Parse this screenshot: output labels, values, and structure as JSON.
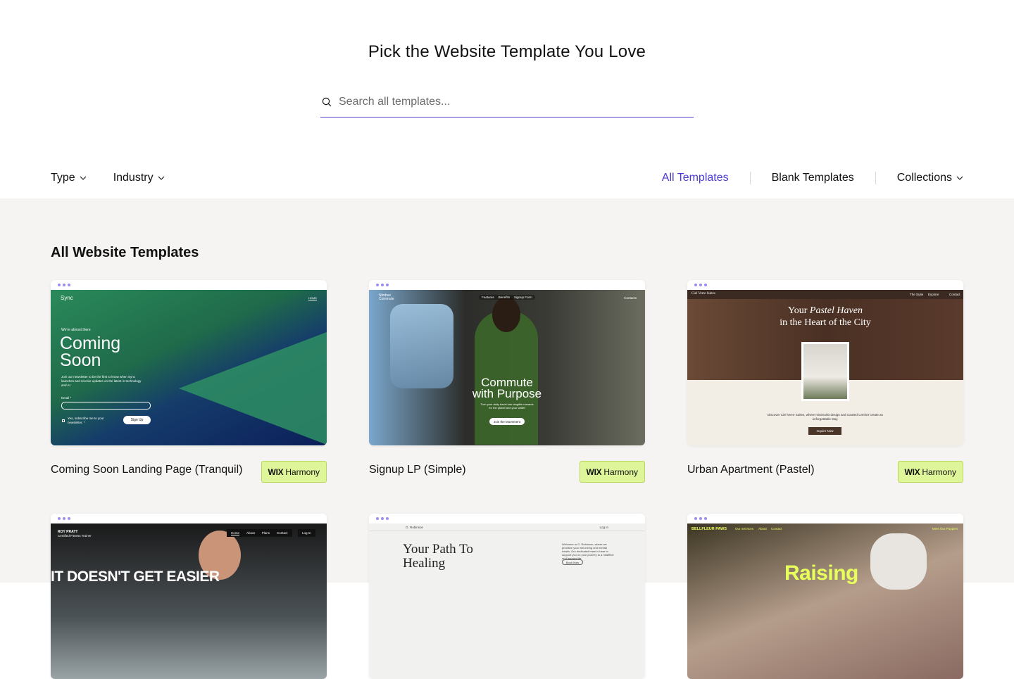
{
  "header": {
    "title": "Pick the Website Template You Love",
    "search_placeholder": "Search all templates..."
  },
  "filters": [
    {
      "label": "Type"
    },
    {
      "label": "Industry"
    }
  ],
  "tabs": [
    {
      "label": "All Templates",
      "active": true
    },
    {
      "label": "Blank Templates"
    },
    {
      "label": "Collections"
    }
  ],
  "section_title": "All Website Templates",
  "badge": {
    "brand": "WIX",
    "label": "Harmony"
  },
  "cards": [
    {
      "name": "Coming Soon Landing Page (Tranquil)",
      "preview": {
        "logo": "Sync",
        "nav": "HOME",
        "kicker": "We're almost there",
        "headline1": "Coming",
        "headline2": "Soon",
        "body": "Join our newsletter to be the first to know when Sync launches and receive updates on the latest in technology and AI.",
        "email_label": "Email *",
        "checkbox": "Yes, subscribe me to your newsletter. *",
        "button": "Sign Up"
      }
    },
    {
      "name": "Signup LP (Simple)",
      "preview": {
        "logo": "Nimbus Commute",
        "nav1": "Features",
        "nav2": "Benefits",
        "nav3": "Signup Form",
        "nav4": "Contacts",
        "headline1": "Commute",
        "headline2": "with Purpose",
        "body": "Turn your daily travel into tangible rewards for the planet and your wallet",
        "button": "Join the Movement"
      }
    },
    {
      "name": "Urban Apartment (Pastel)",
      "preview": {
        "logo": "Ciel Verre Suites",
        "nav1": "The Suite",
        "nav2": "Explore",
        "nav3": "Contact",
        "headline1a": "Your ",
        "headline1b": "Pastel Haven",
        "headline2": "in the Heart of the City",
        "body": "Discover Ciel Verre Suites, where minimalist design and curated comfort create an unforgettable stay.",
        "button": "Inquire Now"
      }
    },
    {
      "name": "",
      "preview": {
        "logo": "ROY PRATT",
        "sub": "Certified Fitness Trainer",
        "nav1": "Home",
        "nav2": "About",
        "nav3": "Plans",
        "nav4": "Contact",
        "login": "Log In",
        "headline": "IT DOESN'T GET EASIER"
      }
    },
    {
      "name": "",
      "preview": {
        "logo": "G. Robinson",
        "login": "Log In",
        "headline1": "Your Path To",
        "headline2": "Healing",
        "body": "Welcome to G. Robinson, where we prioritize your well-being and mental health. Our dedicated team is here to support you on your journey to a healthier and happier life.",
        "button": "Book Now"
      }
    },
    {
      "name": "",
      "preview": {
        "logo": "BELLFLEUR PAWS",
        "nav1": "Our Services",
        "nav2": "About",
        "nav3": "Contact",
        "nav4": "Meet Our Puppies",
        "headline": "Raising"
      }
    }
  ]
}
